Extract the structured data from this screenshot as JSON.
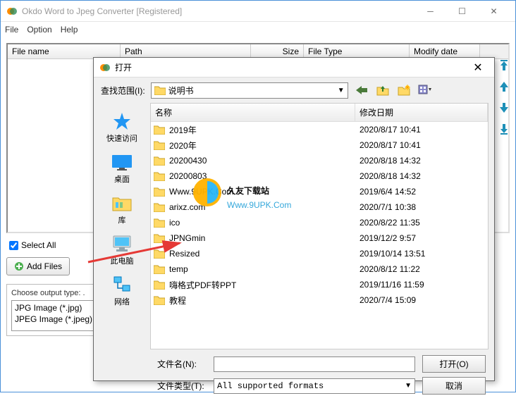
{
  "window": {
    "title": "Okdo Word to Jpeg Converter [Registered]"
  },
  "menu": {
    "file": "File",
    "option": "Option",
    "help": "Help"
  },
  "columns": {
    "name": "File name",
    "path": "Path",
    "size": "Size",
    "type": "File Type",
    "modify": "Modify date"
  },
  "controls": {
    "select_all": "Select All",
    "add_files": "Add Files"
  },
  "output": {
    "label": "Choose output type:  .",
    "formats": [
      "JPG Image (*.jpg)",
      "JPEG Image (*.jpeg)"
    ]
  },
  "dialog": {
    "title": "打开",
    "lookin_label": "查找范围(I):",
    "lookin_value": "说明书",
    "col_name": "名称",
    "col_date": "修改日期",
    "places": {
      "quick": "快速访问",
      "desktop": "桌面",
      "library": "库",
      "thispc": "此电脑",
      "network": "网络"
    },
    "files": [
      {
        "name": "2019年",
        "date": "2020/8/17 10:41"
      },
      {
        "name": "2020年",
        "date": "2020/8/17 10:41"
      },
      {
        "name": "20200430",
        "date": "2020/8/18 14:32"
      },
      {
        "name": "20200803",
        "date": "2020/8/18 14:32"
      },
      {
        "name": "Www.9UPK.Com",
        "date": "2019/6/4 14:52"
      },
      {
        "name": "arixz.com",
        "date": "2020/7/1 10:38"
      },
      {
        "name": "ico",
        "date": "2020/8/22 11:35"
      },
      {
        "name": "JPNGmin",
        "date": "2019/12/2 9:57"
      },
      {
        "name": "Resized",
        "date": "2019/10/14 13:51"
      },
      {
        "name": "temp",
        "date": "2020/8/12 11:22"
      },
      {
        "name": "嗨格式PDF转PPT",
        "date": "2019/11/16 11:59"
      },
      {
        "name": "教程",
        "date": "2020/7/4 15:09"
      }
    ],
    "filename_label": "文件名(N):",
    "filetype_label": "文件类型(T):",
    "filetype_value": "All supported formats",
    "open_btn": "打开(O)",
    "cancel_btn": "取消"
  },
  "watermark": {
    "line1": "久友下载站",
    "line2": "Www.9UPK.Com"
  }
}
